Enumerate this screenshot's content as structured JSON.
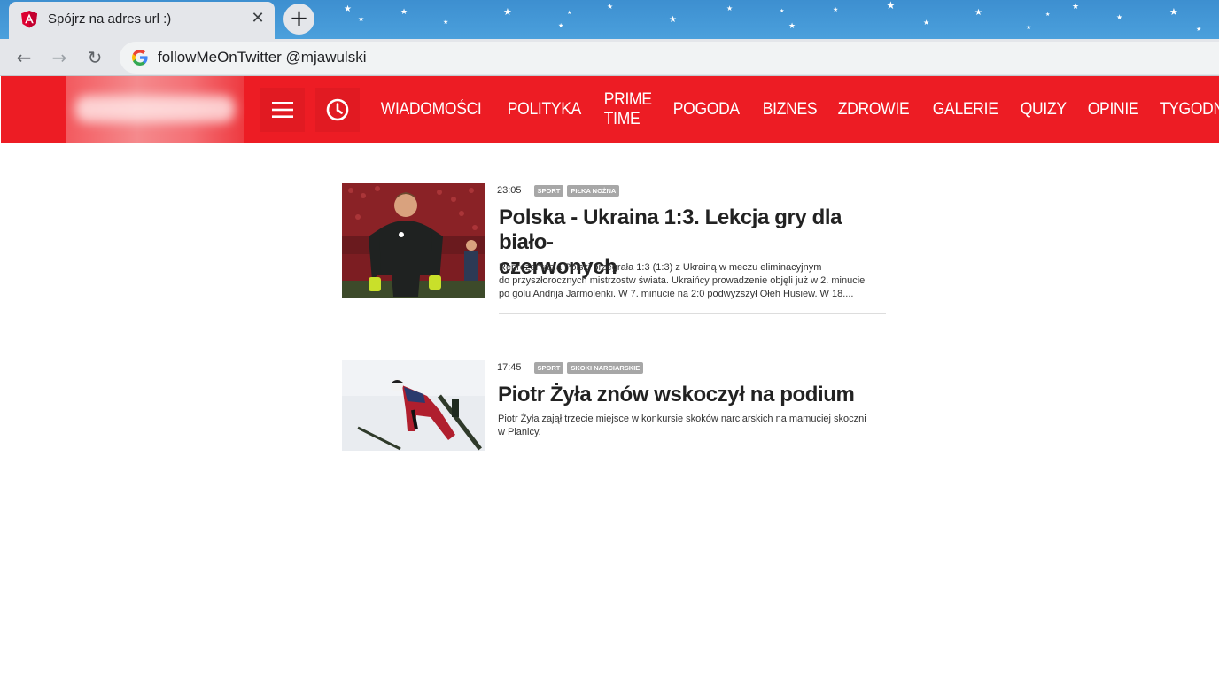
{
  "browser": {
    "tab_title": "Spójrz na adres url :)",
    "tab_close_glyph": "✕",
    "new_tab_glyph": "+",
    "back_glyph": "←",
    "forward_glyph": "→",
    "reload_glyph": "↻",
    "url": "followMeOnTwitter @mjawulski",
    "favicon": "angular-icon",
    "search_engine_icon": "google-icon"
  },
  "header": {
    "bg_color": "#ed1c24",
    "menu_icon": "hamburger-icon",
    "clock_icon": "clock-icon",
    "nav": [
      "WIADOMOŚCI",
      "POLITYKA",
      "PRIME TIME",
      "POGODA",
      "BIZNES",
      "ZDROWIE",
      "GALERIE",
      "QUIZY",
      "OPINIE",
      "TYGODNIK"
    ]
  },
  "articles": [
    {
      "time": "23:05",
      "tags": [
        "SPORT",
        "PIŁKA NOŻNA"
      ],
      "title_lines": [
        "Polska - Ukraina 1:3. Lekcja gry dla biało-",
        "czerwonych"
      ],
      "lead_lines": [
        "Reprezentacja Polski przegrała 1:3 (1:3) z Ukrainą w meczu eliminacyjnym",
        "do przyszłorocznych mistrzostw świata. Ukraińcy prowadzenie objęli już w 2. minucie",
        "po golu Andrija Jarmolenki. W 7. minucie na 2:0 podwyższył Ołeh Husiew. W 18...."
      ]
    },
    {
      "time": "17:45",
      "tags": [
        "SPORT",
        "SKOKI NARCIARSKIE"
      ],
      "title_lines": [
        "Piotr Żyła znów wskoczył na podium"
      ],
      "lead_lines": [
        "Piotr Żyła zajął trzecie miejsce w konkursie skoków narciarskich na mamuciej skoczni",
        "w Planicy."
      ]
    }
  ]
}
